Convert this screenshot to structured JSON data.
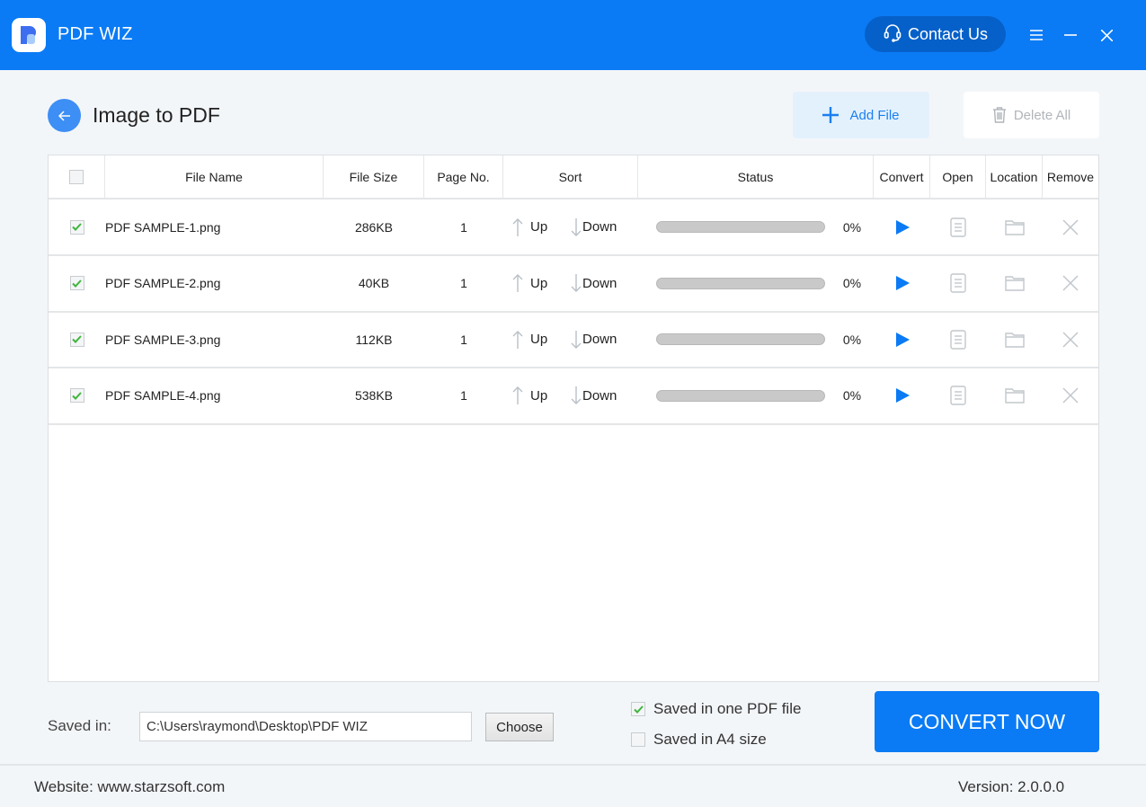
{
  "app": {
    "title": "PDF WIZ",
    "contact_label": "Contact Us",
    "accent_color": "#0a7bf5"
  },
  "page": {
    "title": "Image to PDF",
    "add_file_label": "Add File",
    "delete_all_label": "Delete All"
  },
  "table": {
    "headers": {
      "file_name": "File Name",
      "file_size": "File Size",
      "page_no": "Page No.",
      "sort": "Sort",
      "status": "Status",
      "convert": "Convert",
      "open": "Open",
      "location": "Location",
      "remove": "Remove"
    },
    "select_all_checked": false,
    "sort_up_label": "Up",
    "sort_down_label": "Down",
    "rows": [
      {
        "checked": true,
        "name": "PDF SAMPLE-1.png",
        "size": "286KB",
        "pages": "1",
        "progress": 0,
        "percent": "0%"
      },
      {
        "checked": true,
        "name": "PDF SAMPLE-2.png",
        "size": "40KB",
        "pages": "1",
        "progress": 0,
        "percent": "0%"
      },
      {
        "checked": true,
        "name": "PDF SAMPLE-3.png",
        "size": "112KB",
        "pages": "1",
        "progress": 0,
        "percent": "0%"
      },
      {
        "checked": true,
        "name": "PDF SAMPLE-4.png",
        "size": "538KB",
        "pages": "1",
        "progress": 0,
        "percent": "0%"
      }
    ]
  },
  "bottom": {
    "saved_in_label": "Saved in:",
    "saved_path": "C:\\Users\\raymond\\Desktop\\PDF WIZ",
    "choose_label": "Choose",
    "options": [
      {
        "label": "Saved in one PDF file",
        "checked": true
      },
      {
        "label": "Saved in A4 size",
        "checked": false
      }
    ],
    "convert_now_label": "CONVERT NOW"
  },
  "footer": {
    "website": "Website: www.starzsoft.com",
    "version": "Version:  2.0.0.0"
  }
}
